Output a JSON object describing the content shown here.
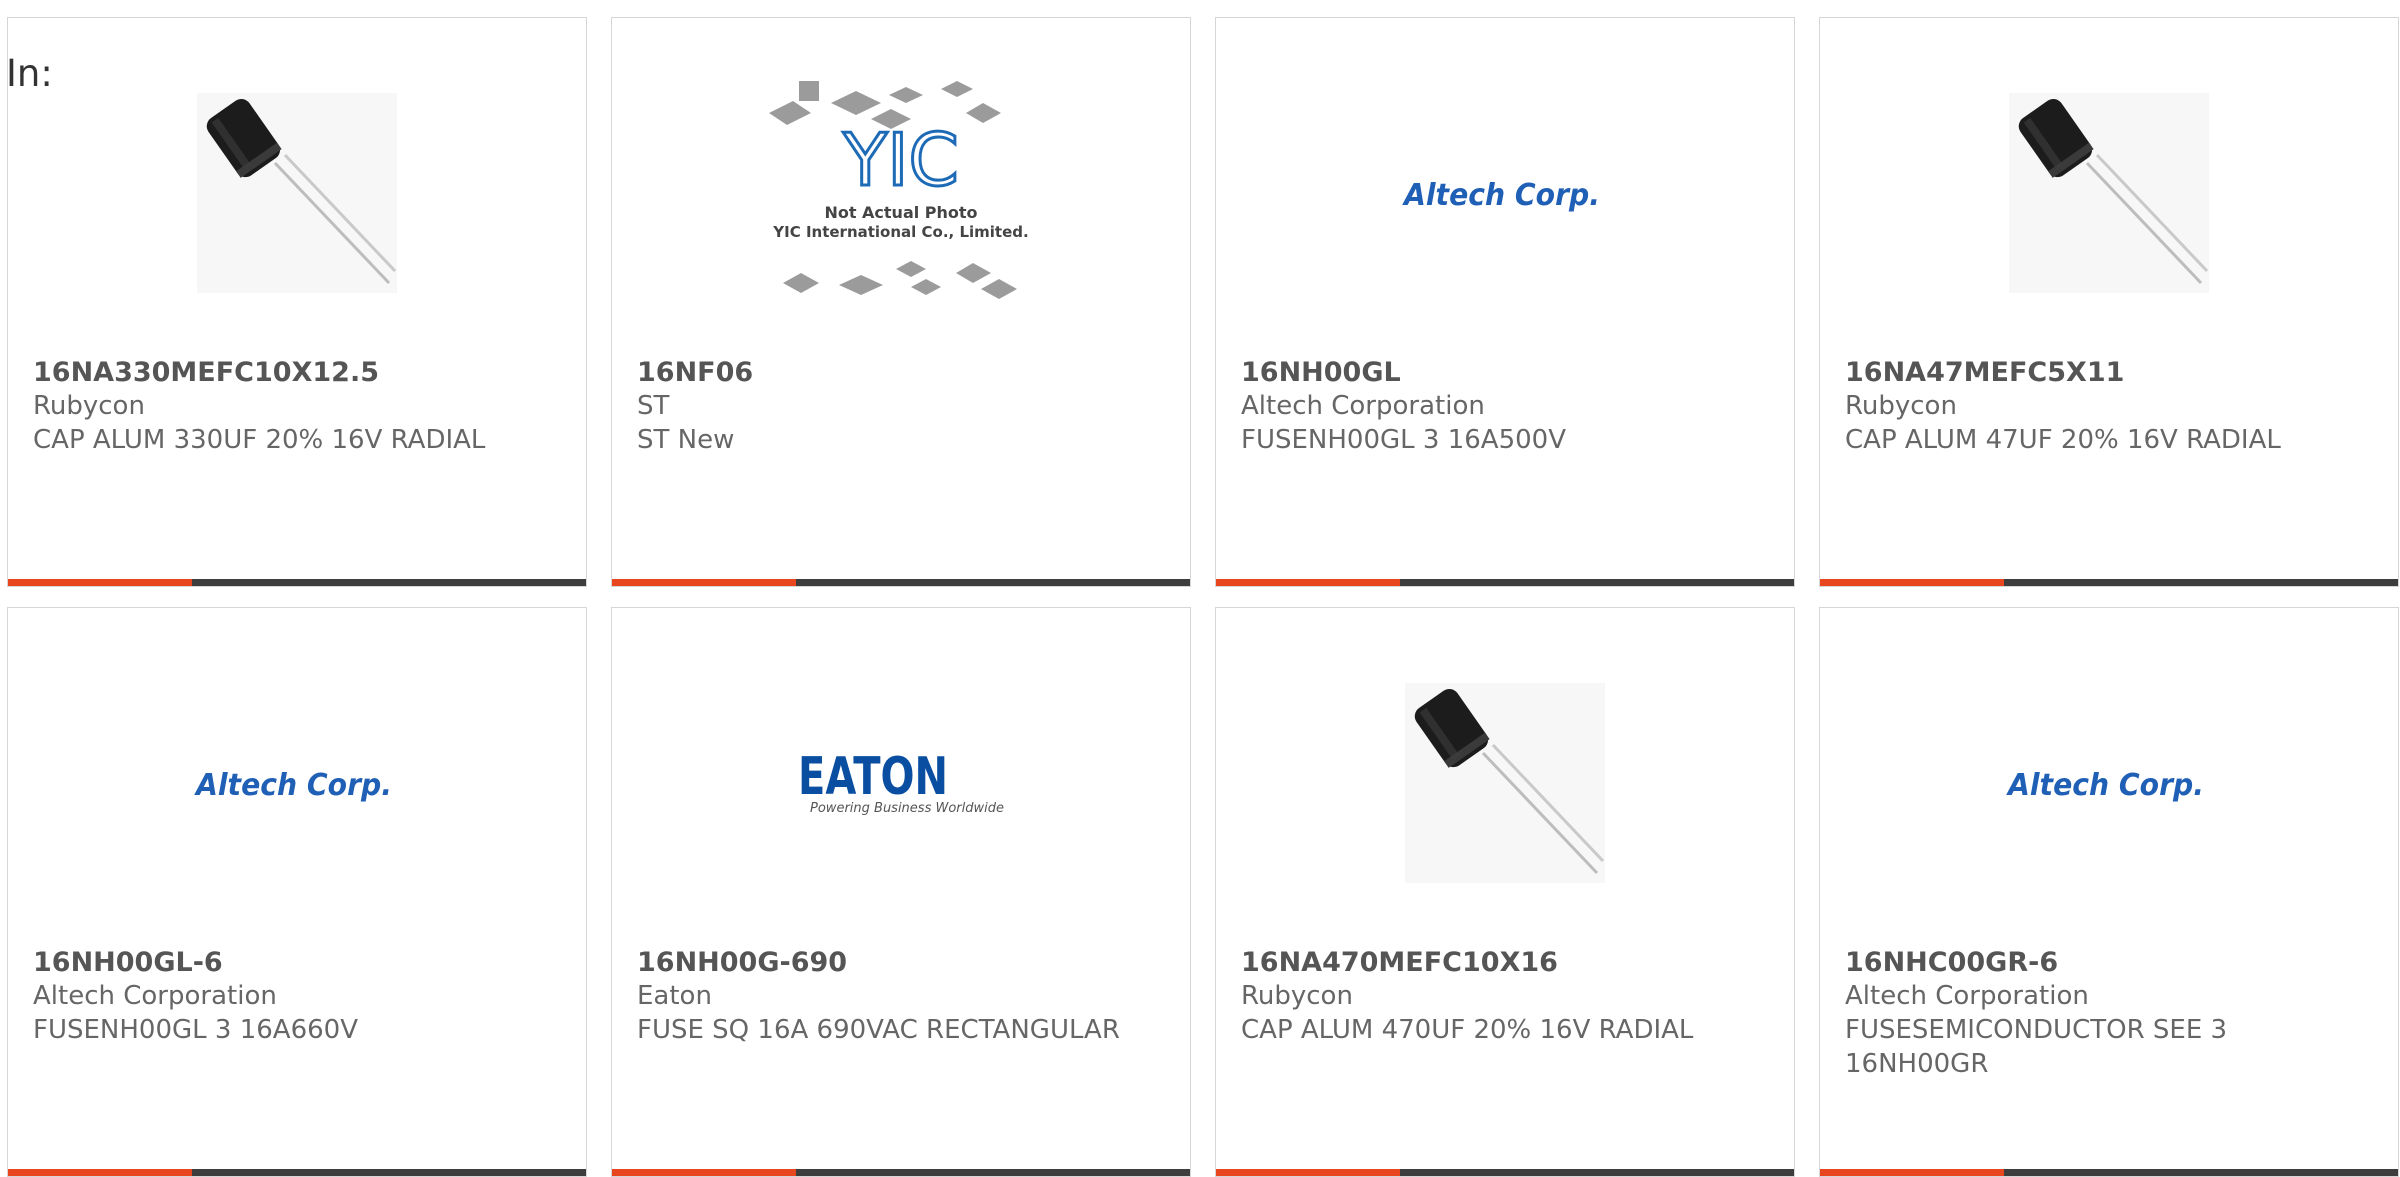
{
  "filter": {
    "label": "In:"
  },
  "products": [
    {
      "part_number": "16NA330MEFC10X12.5",
      "manufacturer": "Rubycon",
      "description": "CAP ALUM 330UF 20% 16V RADIAL",
      "image": "capacitor-photo"
    },
    {
      "part_number": "16NF06",
      "manufacturer": "ST",
      "description": "ST New",
      "image": "yic-not-actual-photo",
      "image_text": {
        "brand": "YIC",
        "line1": "Not Actual Photo",
        "line2": "YIC International Co., Limited."
      }
    },
    {
      "part_number": "16NH00GL",
      "manufacturer": "Altech Corporation",
      "description": "FUSENH00GL 3 16A500V",
      "image": "altech-logo",
      "image_text": {
        "brand": "Altech Corp."
      }
    },
    {
      "part_number": "16NA47MEFC5X11",
      "manufacturer": "Rubycon",
      "description": "CAP ALUM 47UF 20% 16V RADIAL",
      "image": "capacitor-photo"
    },
    {
      "part_number": "16NH00GL-6",
      "manufacturer": "Altech Corporation",
      "description": "FUSENH00GL 3 16A660V",
      "image": "altech-logo",
      "image_text": {
        "brand": "Altech Corp."
      }
    },
    {
      "part_number": "16NH00G-690",
      "manufacturer": "Eaton",
      "description": "FUSE SQ 16A 690VAC RECTANGULAR",
      "image": "eaton-logo",
      "image_text": {
        "brand": "EATON",
        "tagline": "Powering Business Worldwide"
      }
    },
    {
      "part_number": "16NA470MEFC10X16",
      "manufacturer": "Rubycon",
      "description": "CAP ALUM 470UF 20% 16V RADIAL",
      "image": "capacitor-photo"
    },
    {
      "part_number": "16NHC00GR-6",
      "manufacturer": "Altech Corporation",
      "description": "FUSESEMICONDUCTOR SEE 3 16NH00GR",
      "image": "altech-logo",
      "image_text": {
        "brand": "Altech Corp."
      }
    }
  ],
  "colors": {
    "accent": "#e8461e",
    "bar": "#3d3d3d",
    "text": "#666666",
    "altech_blue": "#1f5fb5",
    "eaton_blue": "#0a4ea2",
    "yic_blue": "#1d6bb7"
  }
}
